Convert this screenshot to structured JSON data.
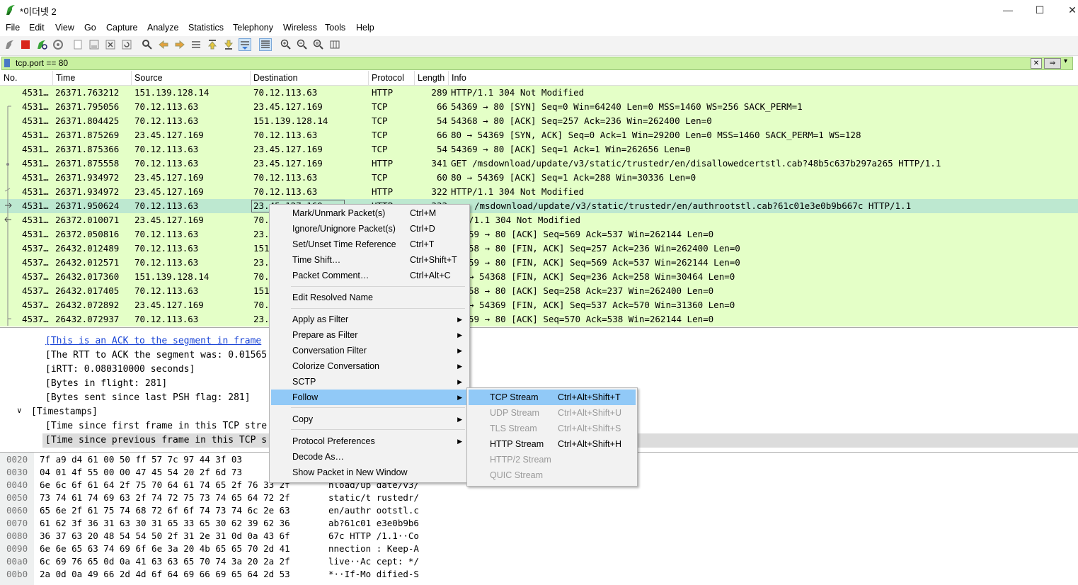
{
  "window": {
    "title": "*이더넷 2",
    "minimize": "—",
    "maximize": "☐",
    "close": "✕"
  },
  "menubar": [
    "File",
    "Edit",
    "View",
    "Go",
    "Capture",
    "Analyze",
    "Statistics",
    "Telephony",
    "Wireless",
    "Tools",
    "Help"
  ],
  "filter": {
    "value": "tcp.port == 80"
  },
  "columns": [
    "No.",
    "Time",
    "Source",
    "Destination",
    "Protocol",
    "Length",
    "Info"
  ],
  "packets": [
    {
      "no": "4531…",
      "time": "26371.763212",
      "src": "151.139.128.14",
      "dst": "70.12.113.63",
      "proto": "HTTP",
      "len": "289",
      "info": "HTTP/1.1 304 Not Modified"
    },
    {
      "no": "4531…",
      "time": "26371.795056",
      "src": "70.12.113.63",
      "dst": "23.45.127.169",
      "proto": "TCP",
      "len": "66",
      "info": "54369 → 80 [SYN] Seq=0 Win=64240 Len=0 MSS=1460 WS=256 SACK_PERM=1"
    },
    {
      "no": "4531…",
      "time": "26371.804425",
      "src": "70.12.113.63",
      "dst": "151.139.128.14",
      "proto": "TCP",
      "len": "54",
      "info": "54368 → 80 [ACK] Seq=257 Ack=236 Win=262400 Len=0"
    },
    {
      "no": "4531…",
      "time": "26371.875269",
      "src": "23.45.127.169",
      "dst": "70.12.113.63",
      "proto": "TCP",
      "len": "66",
      "info": "80 → 54369 [SYN, ACK] Seq=0 Ack=1 Win=29200 Len=0 MSS=1460 SACK_PERM=1 WS=128"
    },
    {
      "no": "4531…",
      "time": "26371.875366",
      "src": "70.12.113.63",
      "dst": "23.45.127.169",
      "proto": "TCP",
      "len": "54",
      "info": "54369 → 80 [ACK] Seq=1 Ack=1 Win=262656 Len=0"
    },
    {
      "no": "4531…",
      "time": "26371.875558",
      "src": "70.12.113.63",
      "dst": "23.45.127.169",
      "proto": "HTTP",
      "len": "341",
      "info": "GET /msdownload/update/v3/static/trustedr/en/disallowedcertstl.cab?48b5c637b297a265 HTTP/1.1"
    },
    {
      "no": "4531…",
      "time": "26371.934972",
      "src": "23.45.127.169",
      "dst": "70.12.113.63",
      "proto": "TCP",
      "len": "60",
      "info": "80 → 54369 [ACK] Seq=1 Ack=288 Win=30336 Len=0"
    },
    {
      "no": "4531…",
      "time": "26371.934972",
      "src": "23.45.127.169",
      "dst": "70.12.113.63",
      "proto": "HTTP",
      "len": "322",
      "info": "HTTP/1.1 304 Not Modified"
    },
    {
      "no": "4531…",
      "time": "26371.950624",
      "src": "70.12.113.63",
      "dst": "23.45.127.169",
      "proto": "HTTP",
      "len": "333",
      "info": "/msdownload/update/v3/static/trustedr/en/authrootstl.cab?61c01e3e0b9b667c HTTP/1.1"
    },
    {
      "no": "4531…",
      "time": "26372.010071",
      "src": "23.45.127.169",
      "dst": "70.",
      "proto": "",
      "len": "",
      "info": "/1.1 304 Not Modified"
    },
    {
      "no": "4531…",
      "time": "26372.050816",
      "src": "70.12.113.63",
      "dst": "23.",
      "proto": "",
      "len": "",
      "info": "59 → 80 [ACK] Seq=569 Ack=537 Win=262144 Len=0"
    },
    {
      "no": "4537…",
      "time": "26432.012489",
      "src": "70.12.113.63",
      "dst": "151",
      "proto": "",
      "len": "",
      "info": "58 → 80 [FIN, ACK] Seq=257 Ack=236 Win=262400 Len=0"
    },
    {
      "no": "4537…",
      "time": "26432.012571",
      "src": "70.12.113.63",
      "dst": "23.",
      "proto": "",
      "len": "",
      "info": "59 → 80 [FIN, ACK] Seq=569 Ack=537 Win=262144 Len=0"
    },
    {
      "no": "4537…",
      "time": "26432.017360",
      "src": "151.139.128.14",
      "dst": "70.",
      "proto": "",
      "len": "",
      "info": "→ 54368 [FIN, ACK] Seq=236 Ack=258 Win=30464 Len=0"
    },
    {
      "no": "4537…",
      "time": "26432.017405",
      "src": "70.12.113.63",
      "dst": "151",
      "proto": "",
      "len": "",
      "info": "58 → 80 [ACK] Seq=258 Ack=237 Win=262400 Len=0"
    },
    {
      "no": "4537…",
      "time": "26432.072892",
      "src": "23.45.127.169",
      "dst": "70.",
      "proto": "",
      "len": "",
      "info": "→ 54369 [FIN, ACK] Seq=537 Ack=570 Win=31360 Len=0"
    },
    {
      "no": "4537…",
      "time": "26432.072937",
      "src": "70.12.113.63",
      "dst": "23.",
      "proto": "",
      "len": "",
      "info": "59 → 80 [ACK] Seq=570 Ack=538 Win=262144 Len=0"
    }
  ],
  "details": [
    {
      "text": "[This is an ACK to the segment in frame",
      "kind": "link",
      "indent": 64
    },
    {
      "text": "[The RTT to ACK the segment was: 0.01565",
      "kind": "",
      "indent": 64
    },
    {
      "text": "[iRTT: 0.080310000 seconds]",
      "kind": "",
      "indent": 64
    },
    {
      "text": "[Bytes in flight: 281]",
      "kind": "",
      "indent": 64
    },
    {
      "text": "[Bytes sent since last PSH flag: 281]",
      "kind": "",
      "indent": 64
    },
    {
      "text": "[Timestamps]",
      "kind": "",
      "indent": 44
    },
    {
      "text": "[Time since first frame in this TCP stre",
      "kind": "",
      "indent": 64
    },
    {
      "text": "[Time since previous frame in this TCP s",
      "kind": "hl",
      "indent": 64
    }
  ],
  "hex": [
    {
      "off": "0020",
      "hex": "7f a9 d4 61 00 50 ff 57  7c 97 44 3f 03",
      "ascii": ""
    },
    {
      "off": "0030",
      "hex": "04 01 4f 55 00 00 47 45  54 20 2f 6d 73",
      "ascii": ""
    },
    {
      "off": "0040",
      "hex": "6e 6c 6f 61 64 2f 75 70  64 61 74 65 2f 76 33 2f",
      "ascii": "nload/up date/v3/"
    },
    {
      "off": "0050",
      "hex": "73 74 61 74 69 63 2f 74  72 75 73 74 65 64 72 2f",
      "ascii": "static/t rustedr/"
    },
    {
      "off": "0060",
      "hex": "65 6e 2f 61 75 74 68 72  6f 6f 74 73 74 6c 2e 63",
      "ascii": "en/authr ootstl.c"
    },
    {
      "off": "0070",
      "hex": "61 62 3f 36 31 63 30 31  65 33 65 30 62 39 62 36",
      "ascii": "ab?61c01 e3e0b9b6"
    },
    {
      "off": "0080",
      "hex": "36 37 63 20 48 54 54 50  2f 31 2e 31 0d 0a 43 6f",
      "ascii": "67c HTTP /1.1··Co"
    },
    {
      "off": "0090",
      "hex": "6e 6e 65 63 74 69 6f 6e  3a 20 4b 65 65 70 2d 41",
      "ascii": "nnection : Keep-A"
    },
    {
      "off": "00a0",
      "hex": "6c 69 76 65 0d 0a 41 63  63 65 70 74 3a 20 2a 2f",
      "ascii": "live··Ac cept: */"
    },
    {
      "off": "00b0",
      "hex": "2a 0d 0a 49 66 2d 4d 6f  64 69 66 69 65 64 2d 53",
      "ascii": "*··If-Mo dified-S"
    }
  ],
  "context_menu": [
    {
      "label": "Mark/Unmark Packet(s)",
      "shortcut": "Ctrl+M",
      "sub": false
    },
    {
      "label": "Ignore/Unignore Packet(s)",
      "shortcut": "Ctrl+D",
      "sub": false
    },
    {
      "label": "Set/Unset Time Reference",
      "shortcut": "Ctrl+T",
      "sub": false
    },
    {
      "label": "Time Shift…",
      "shortcut": "Ctrl+Shift+T",
      "sub": false
    },
    {
      "label": "Packet Comment…",
      "shortcut": "Ctrl+Alt+C",
      "sub": false
    },
    {
      "label": "Edit Resolved Name",
      "shortcut": "",
      "sub": false
    },
    {
      "label": "Apply as Filter",
      "shortcut": "",
      "sub": true
    },
    {
      "label": "Prepare as Filter",
      "shortcut": "",
      "sub": true
    },
    {
      "label": "Conversation Filter",
      "shortcut": "",
      "sub": true
    },
    {
      "label": "Colorize Conversation",
      "shortcut": "",
      "sub": true
    },
    {
      "label": "SCTP",
      "shortcut": "",
      "sub": true
    },
    {
      "label": "Follow",
      "shortcut": "",
      "sub": true
    },
    {
      "label": "Copy",
      "shortcut": "",
      "sub": true
    },
    {
      "label": "Protocol Preferences",
      "shortcut": "",
      "sub": true
    },
    {
      "label": "Decode As…",
      "shortcut": "",
      "sub": false
    },
    {
      "label": "Show Packet in New Window",
      "shortcut": "",
      "sub": false
    }
  ],
  "follow_submenu": [
    {
      "label": "TCP Stream",
      "shortcut": "Ctrl+Alt+Shift+T",
      "enabled": true
    },
    {
      "label": "UDP Stream",
      "shortcut": "Ctrl+Alt+Shift+U",
      "enabled": false
    },
    {
      "label": "TLS Stream",
      "shortcut": "Ctrl+Alt+Shift+S",
      "enabled": false
    },
    {
      "label": "HTTP Stream",
      "shortcut": "Ctrl+Alt+Shift+H",
      "enabled": true
    },
    {
      "label": "HTTP/2 Stream",
      "shortcut": "",
      "enabled": false
    },
    {
      "label": "QUIC Stream",
      "shortcut": "",
      "enabled": false
    }
  ],
  "colors": {
    "row_green": "#e4ffc7",
    "row_selected": "#bde8d0",
    "filter_ok": "#c8f0a0",
    "menu_hover": "#91c9f7"
  }
}
